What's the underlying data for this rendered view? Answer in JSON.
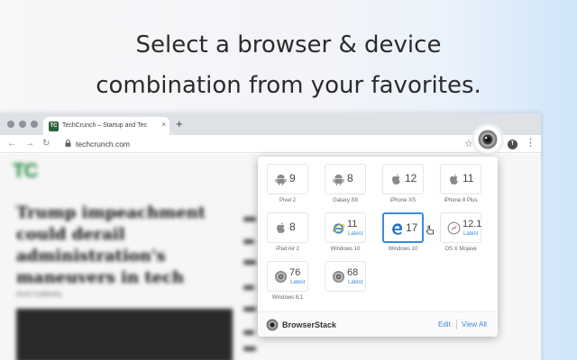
{
  "headline": {
    "line1": "Select a browser & device",
    "line2": "combination from your favorites."
  },
  "browser": {
    "tab_title": "TechCrunch – Startup and Tec",
    "tab_favicon_text": "TC",
    "tab_close": "×",
    "new_tab": "+",
    "url": "techcrunch.com",
    "avatar_letter": "T",
    "back": "←",
    "forward": "→",
    "reload": "↻",
    "star": "☆",
    "menu": "⋮"
  },
  "page": {
    "logo": "TC",
    "article_title": "Trump impeachment could derail administration's maneuvers in tech",
    "article_meta": "Devin Coldewey"
  },
  "popup": {
    "tiles": [
      {
        "icon": "android-icon",
        "version": "9",
        "latest": "",
        "label": "Pixel 2"
      },
      {
        "icon": "android-icon",
        "version": "8",
        "latest": "",
        "label": "Galaxy S9"
      },
      {
        "icon": "apple-icon",
        "version": "12",
        "latest": "",
        "label": "iPhone XS"
      },
      {
        "icon": "apple-icon",
        "version": "11",
        "latest": "",
        "label": "iPhone 8 Plus"
      },
      {
        "icon": "apple-icon",
        "version": "8",
        "latest": "",
        "label": "iPad Air 2"
      },
      {
        "icon": "ie-icon",
        "version": "11",
        "latest": "Latest",
        "label": "Windows 10"
      },
      {
        "icon": "edge-icon",
        "version": "17",
        "latest": "",
        "label": "Windows 10"
      },
      {
        "icon": "safari-icon",
        "version": "12.1",
        "latest": "Latest",
        "label": "OS X Mojave"
      },
      {
        "icon": "chrome-icon",
        "version": "76",
        "latest": "Latest",
        "label": "Windows 8.1"
      },
      {
        "icon": "chrome-icon",
        "version": "68",
        "latest": "Latest",
        "label": ""
      }
    ],
    "selected_index": 6,
    "brand": "BrowserStack",
    "edit": "Edit",
    "view_all": "View All"
  },
  "colors": {
    "accent": "#3a8bd8",
    "techcrunch_green": "#1f8a3b"
  }
}
